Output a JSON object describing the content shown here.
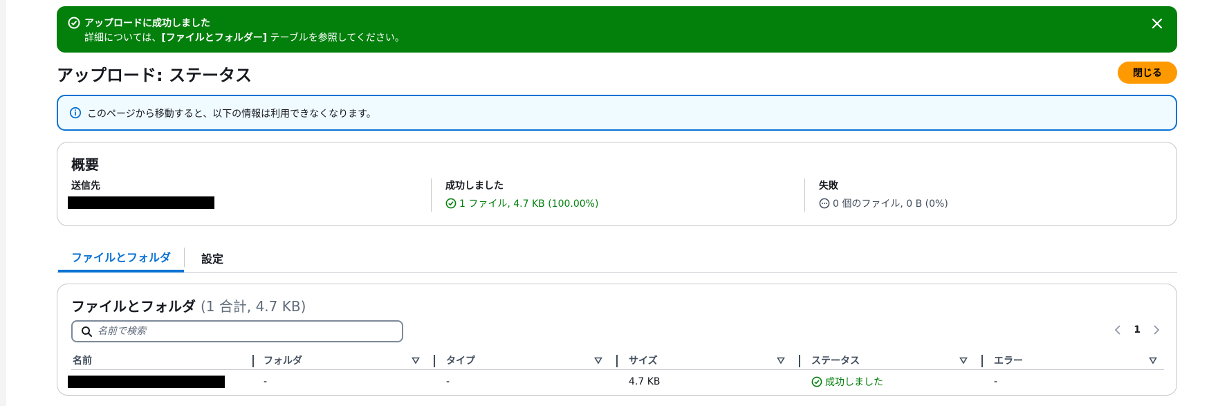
{
  "flash": {
    "title": "アップロードに成功しました",
    "body_prefix": "詳細については、",
    "body_bold": "[ファイルとフォルダー]",
    "body_suffix": " テーブルを参照してください。",
    "icons": {
      "status": "success-check-circle-icon",
      "close": "close-x-icon"
    },
    "color": "#037f0c"
  },
  "header": {
    "title": "アップロード: ステータス",
    "close_button": "閉じる",
    "close_button_color": "#ff9900"
  },
  "info_alert": {
    "text": "このページから移動すると、以下の情報は利用できなくなります。",
    "icon": "info-circle-icon",
    "color": "#0972d3"
  },
  "summary": {
    "title": "概要",
    "destination_label": "送信先",
    "destination_value_redacted": true,
    "succeeded_label": "成功しました",
    "succeeded_value": "1 ファイル, 4.7 KB (100.00%)",
    "failed_label": "失敗",
    "failed_value": "0 個のファイル, 0 B (0%)"
  },
  "tabs": [
    {
      "label": "ファイルとフォルダ",
      "active": true
    },
    {
      "label": "設定",
      "active": false
    }
  ],
  "files": {
    "title": "ファイルとフォルダ",
    "count": "(1 合計, 4.7 KB)",
    "search_placeholder": "名前で検索",
    "pagination": {
      "current": "1"
    },
    "columns": [
      "名前",
      "フォルダ",
      "タイプ",
      "サイズ",
      "ステータス",
      "エラー"
    ],
    "rows": [
      {
        "name_redacted": true,
        "folder": "-",
        "type": "-",
        "size": "4.7 KB",
        "status": "成功しました",
        "error": "-"
      }
    ]
  }
}
